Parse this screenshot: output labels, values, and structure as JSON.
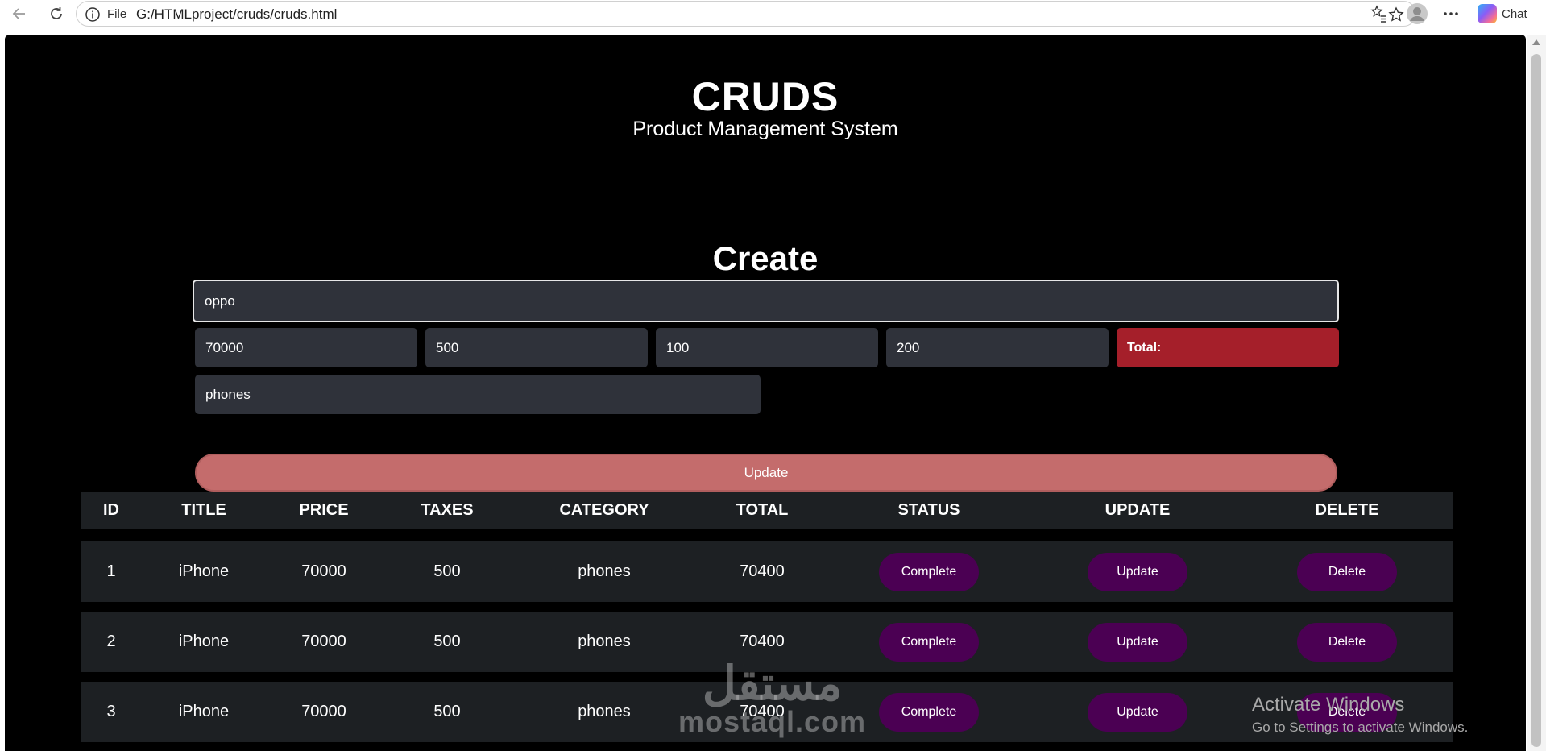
{
  "browser": {
    "file_label": "File",
    "url": "G:/HTMLproject/cruds/cruds.html",
    "chat_label": "Chat",
    "icons": [
      "back-icon",
      "refresh-icon",
      "info-icon",
      "star-icon",
      "favorites-icon",
      "profile-icon",
      "more-icon"
    ]
  },
  "header": {
    "title": "CRUDS",
    "subtitle": "Product Management System"
  },
  "form": {
    "heading": "Create",
    "title_value": "oppo",
    "price_value": "70000",
    "taxes_value": "500",
    "ads_value": "100",
    "discount_value": "200",
    "total_label": "Total:",
    "category_value": "phones",
    "submit_label": "Update",
    "total_color": "#a51f2a",
    "submit_color": "#c46c6c"
  },
  "table": {
    "headers": [
      "ID",
      "TITLE",
      "PRICE",
      "TAXES",
      "CATEGORY",
      "TOTAL",
      "STATUS",
      "UPDATE",
      "DELETE"
    ],
    "rows": [
      {
        "id": "1",
        "title": "iPhone",
        "price": "70000",
        "taxes": "500",
        "category": "phones",
        "total": "70400",
        "status": "Complete",
        "update": "Update",
        "delete": "Delete"
      },
      {
        "id": "2",
        "title": "iPhone",
        "price": "70000",
        "taxes": "500",
        "category": "phones",
        "total": "70400",
        "status": "Complete",
        "update": "Update",
        "delete": "Delete"
      },
      {
        "id": "3",
        "title": "iPhone",
        "price": "70000",
        "taxes": "500",
        "category": "phones",
        "total": "70400",
        "status": "Complete",
        "update": "Update",
        "delete": "Delete"
      }
    ],
    "button_color": "#4b0053"
  },
  "watermark": {
    "arabic": "مستقل",
    "latin": "mostaql.com"
  },
  "windows_notice": {
    "line1": "Activate Windows",
    "line2": "Go to Settings to activate Windows."
  }
}
